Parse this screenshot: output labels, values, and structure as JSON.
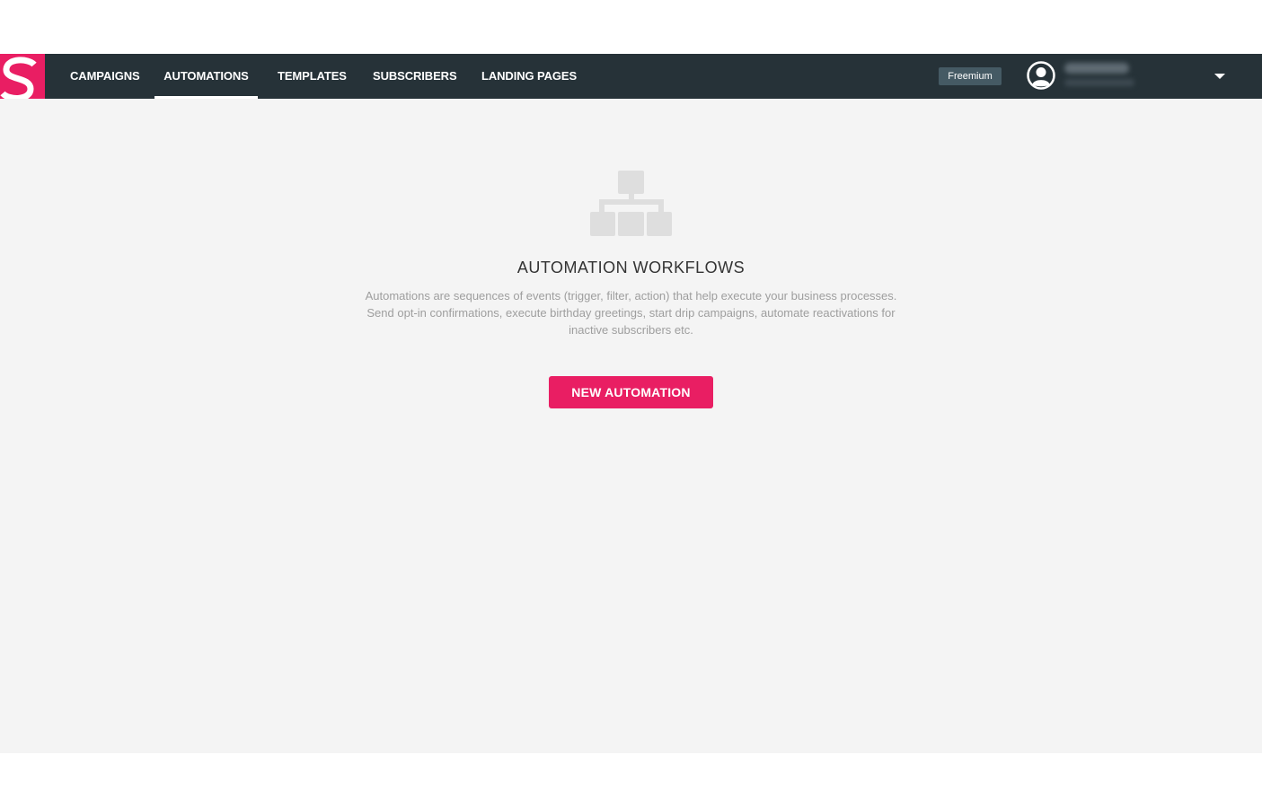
{
  "brand": {
    "logo_letter": "S",
    "accent_color": "#e91e63",
    "navbar_color": "#263238"
  },
  "nav": {
    "items": [
      {
        "label": "CAMPAIGNS",
        "active": false
      },
      {
        "label": "AUTOMATIONS",
        "active": true
      },
      {
        "label": "TEMPLATES",
        "active": false
      },
      {
        "label": "SUBSCRIBERS",
        "active": false
      },
      {
        "label": "LANDING PAGES",
        "active": false
      }
    ]
  },
  "account": {
    "plan_badge": "Freemium",
    "avatar_icon": "user-circle-icon",
    "menu_icon": "caret-down-icon"
  },
  "empty_state": {
    "icon": "sitemap-icon",
    "title": "AUTOMATION WORKFLOWS",
    "description": "Automations are sequences of events (trigger, filter, action) that help execute your business processes. Send opt-in confirmations, execute birthday greetings, start drip campaigns, automate reactivations for inactive subscribers etc.",
    "button_label": "NEW AUTOMATION"
  }
}
